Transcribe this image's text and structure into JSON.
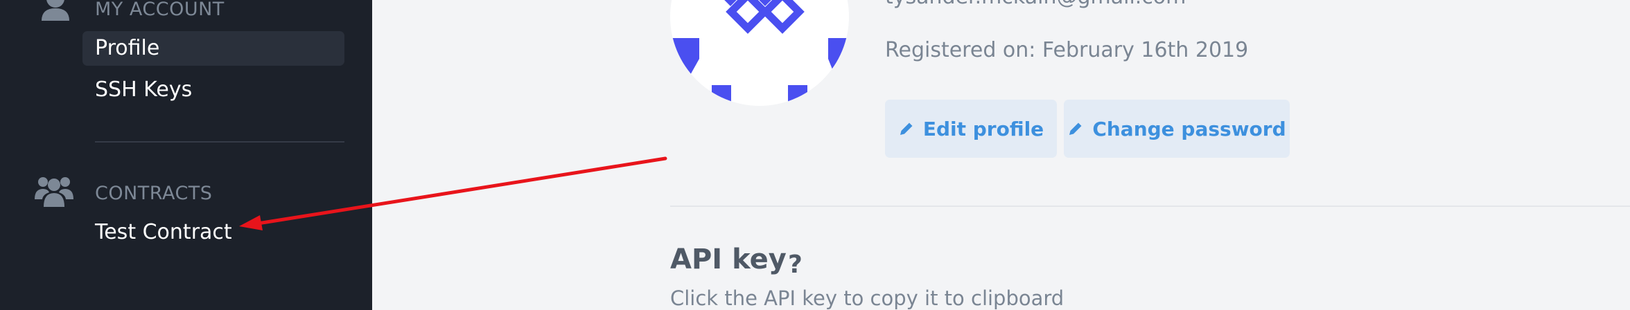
{
  "sidebar": {
    "account_title": "MY ACCOUNT",
    "account_items": [
      {
        "label": "Profile",
        "active": true
      },
      {
        "label": "SSH Keys",
        "active": false
      }
    ],
    "contracts_title": "CONTRACTS",
    "contract_items": [
      {
        "label": "Test Contract"
      }
    ]
  },
  "profile": {
    "email": "tysander.mckain@gmail.com",
    "registered": "Registered on: February 16th 2019",
    "edit_label": "Edit profile",
    "password_label": "Change password"
  },
  "api": {
    "title": "API key",
    "help": "?",
    "subtitle": "Click the API key to copy it to clipboard"
  },
  "colors": {
    "sidebar_bg": "#1c212a",
    "main_bg": "#f3f4f6",
    "accent": "#3d90de",
    "avatar_pattern": "#4a4ff0",
    "annotation_arrow": "#e8141b"
  },
  "icons": {
    "account": "user-icon",
    "contracts": "users-icon",
    "edit": "pencil-icon",
    "password": "pencil-icon"
  }
}
